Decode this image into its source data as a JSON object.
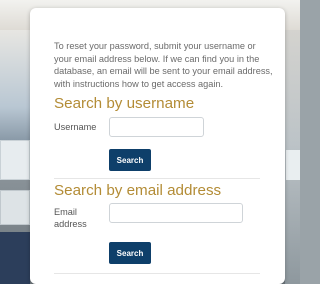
{
  "intro_text": "To reset your password, submit your username or your email address below. If we can find you in the database, an email will be sent to your email address, with instructions how to get access again.",
  "search_by_username": {
    "title": "Search by username",
    "field_label": "Username",
    "input_value": "",
    "button_label": "Search"
  },
  "search_by_email": {
    "title": "Search by email address",
    "field_label": "Email address",
    "input_value": "",
    "button_label": "Search"
  },
  "colors": {
    "accent": "#b38c36",
    "button": "#0e3f6a",
    "body_text": "#6b6b6b"
  }
}
